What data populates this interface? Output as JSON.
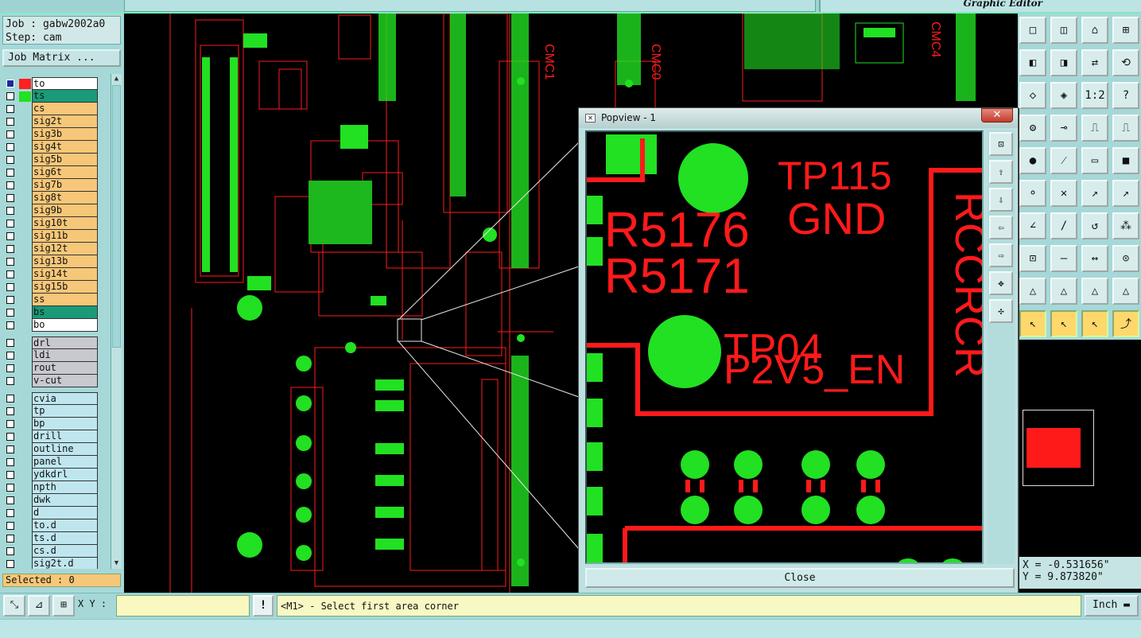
{
  "header": {
    "editor_title": "Graphic Editor"
  },
  "job": {
    "job_label": "Job : gabw2002a0",
    "step_label": "Step: cam",
    "matrix_button": "Job Matrix ..."
  },
  "layers": [
    {
      "name": "to",
      "color": "#ffffff",
      "swatch": "#ff2020",
      "group": 1
    },
    {
      "name": "ts",
      "color": "#1a9a78",
      "swatch": "#22e022",
      "group": 1
    },
    {
      "name": "cs",
      "color": "#f7c779",
      "swatch": "",
      "group": 1
    },
    {
      "name": "sig2t",
      "color": "#f7c779",
      "swatch": "",
      "group": 1
    },
    {
      "name": "sig3b",
      "color": "#f7c779",
      "swatch": "",
      "group": 1
    },
    {
      "name": "sig4t",
      "color": "#f7c779",
      "swatch": "",
      "group": 1
    },
    {
      "name": "sig5b",
      "color": "#f7c779",
      "swatch": "",
      "group": 1
    },
    {
      "name": "sig6t",
      "color": "#f7c779",
      "swatch": "",
      "group": 1
    },
    {
      "name": "sig7b",
      "color": "#f7c779",
      "swatch": "",
      "group": 1
    },
    {
      "name": "sig8t",
      "color": "#f7c779",
      "swatch": "",
      "group": 1
    },
    {
      "name": "sig9b",
      "color": "#f7c779",
      "swatch": "",
      "group": 1
    },
    {
      "name": "sig10t",
      "color": "#f7c779",
      "swatch": "",
      "group": 1
    },
    {
      "name": "sig11b",
      "color": "#f7c779",
      "swatch": "",
      "group": 1
    },
    {
      "name": "sig12t",
      "color": "#f7c779",
      "swatch": "",
      "group": 1
    },
    {
      "name": "sig13b",
      "color": "#f7c779",
      "swatch": "",
      "group": 1
    },
    {
      "name": "sig14t",
      "color": "#f7c779",
      "swatch": "",
      "group": 1
    },
    {
      "name": "sig15b",
      "color": "#f7c779",
      "swatch": "",
      "group": 1
    },
    {
      "name": "ss",
      "color": "#f7c779",
      "swatch": "",
      "group": 1
    },
    {
      "name": "bs",
      "color": "#1a9a78",
      "swatch": "",
      "group": 1
    },
    {
      "name": "bo",
      "color": "#ffffff",
      "swatch": "",
      "group": 1
    },
    {
      "name": "drl",
      "color": "#c8c8d0",
      "swatch": "",
      "group": 2
    },
    {
      "name": "ldi",
      "color": "#c8c8d0",
      "swatch": "",
      "group": 2
    },
    {
      "name": "rout",
      "color": "#c8c8d0",
      "swatch": "",
      "group": 2
    },
    {
      "name": "v-cut",
      "color": "#c8c8d0",
      "swatch": "",
      "group": 2
    },
    {
      "name": "cvia",
      "color": "#bfe6ef",
      "swatch": "",
      "group": 3
    },
    {
      "name": "tp",
      "color": "#bfe6ef",
      "swatch": "",
      "group": 3
    },
    {
      "name": "bp",
      "color": "#bfe6ef",
      "swatch": "",
      "group": 3
    },
    {
      "name": "drill",
      "color": "#bfe6ef",
      "swatch": "",
      "group": 3
    },
    {
      "name": "outline",
      "color": "#bfe6ef",
      "swatch": "",
      "group": 3
    },
    {
      "name": "panel",
      "color": "#bfe6ef",
      "swatch": "",
      "group": 3
    },
    {
      "name": "ydkdrl",
      "color": "#bfe6ef",
      "swatch": "",
      "group": 3
    },
    {
      "name": "npth",
      "color": "#bfe6ef",
      "swatch": "",
      "group": 3
    },
    {
      "name": "dwk",
      "color": "#bfe6ef",
      "swatch": "",
      "group": 3
    },
    {
      "name": "d",
      "color": "#bfe6ef",
      "swatch": "",
      "group": 3
    },
    {
      "name": "to.d",
      "color": "#bfe6ef",
      "swatch": "",
      "group": 3
    },
    {
      "name": "ts.d",
      "color": "#bfe6ef",
      "swatch": "",
      "group": 3
    },
    {
      "name": "cs.d",
      "color": "#bfe6ef",
      "swatch": "",
      "group": 3
    },
    {
      "name": "sig2t.d",
      "color": "#bfe6ef",
      "swatch": "",
      "group": 3
    }
  ],
  "selected_label": "Selected : 0",
  "canvas_labels": [
    "CMC1",
    "CMC0",
    "CMC4"
  ],
  "popup": {
    "title": "Popview - 1",
    "close_label": "Close",
    "zoom_texts": [
      "TP115",
      "GND",
      "R5176",
      "R5171",
      "TP04",
      "P2V5_EN",
      "RCCRCR"
    ]
  },
  "coords": {
    "x": "X = -0.531656\"",
    "y": "Y = 9.873820\""
  },
  "bottom": {
    "xy_label": "X Y :",
    "xy_value": "",
    "bang": "!",
    "message": "<M1> - Select first area corner",
    "unit": "Inch"
  },
  "colors": {
    "pad_green": "#22e022",
    "trace_red": "#ff1a1a",
    "bg": "#a6d8d8"
  }
}
